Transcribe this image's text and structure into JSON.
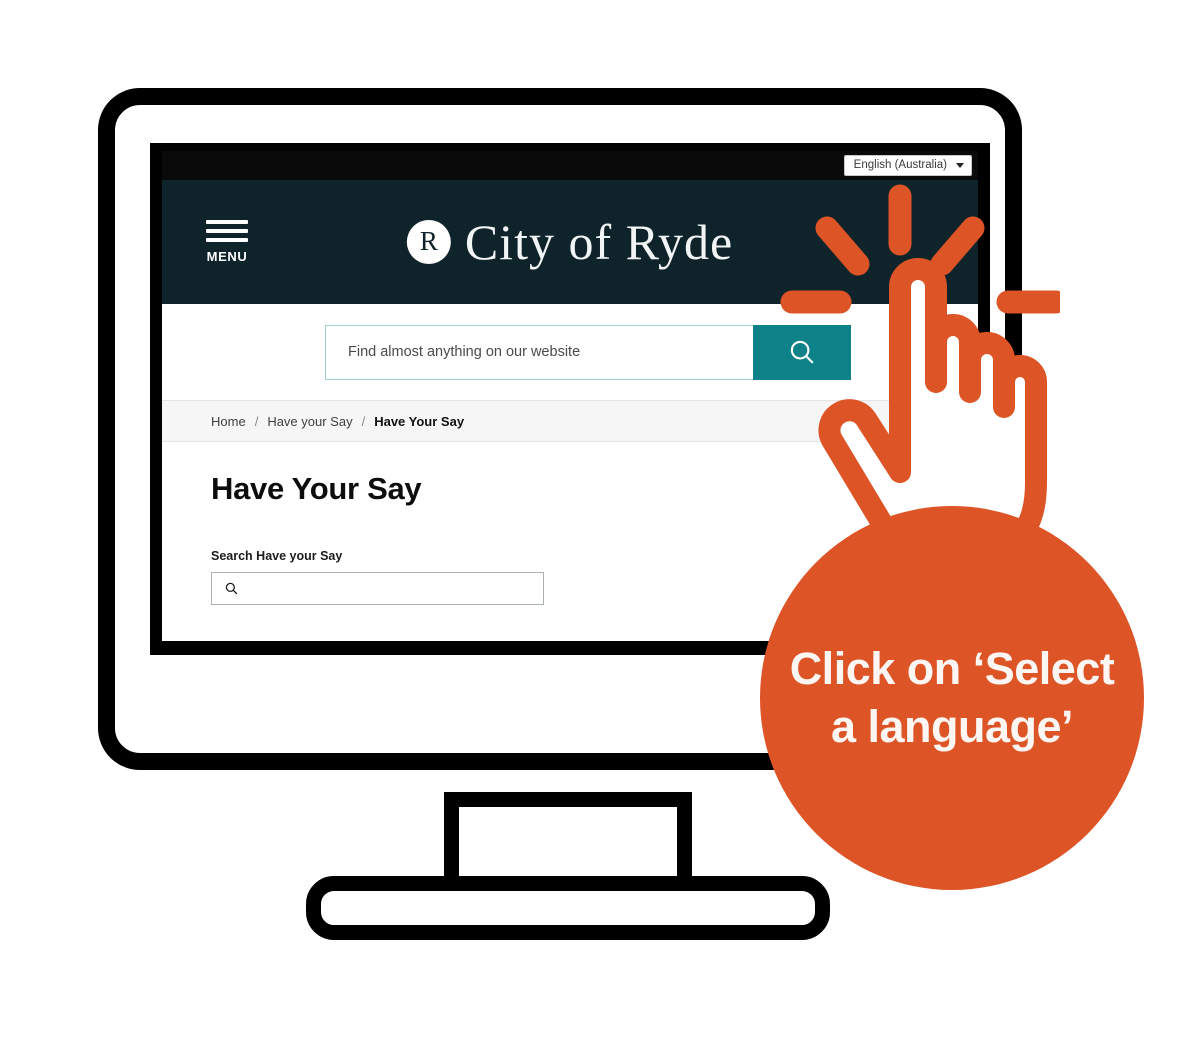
{
  "topbar": {
    "language_selected": "English (Australia)",
    "caret_icon": "chevron-down-icon"
  },
  "header": {
    "menu_label": "MENU",
    "menu_icon": "hamburger-icon",
    "brand_monogram": "R",
    "brand_name": "City of Ryde",
    "background_color": "#0f232b"
  },
  "search": {
    "placeholder": "Find almost anything on our website",
    "value": "",
    "button_icon": "search-icon",
    "button_color": "#0e8289"
  },
  "breadcrumb": {
    "items": [
      {
        "label": "Home",
        "current": false
      },
      {
        "label": "Have your Say",
        "current": false
      },
      {
        "label": "Have Your Say",
        "current": true
      }
    ],
    "separator": "/"
  },
  "main": {
    "title": "Have Your Say",
    "search_field": {
      "label": "Search Have your Say",
      "value": "",
      "placeholder": "",
      "icon": "search-icon"
    }
  },
  "annotation": {
    "callout_text": "Click on ‘Select a language’",
    "callout_color": "#dd5427",
    "pointer_icon": "pointing-hand-cursor-icon",
    "ray_icon": "tap-rays-icon"
  },
  "device": {
    "frame_color": "#000000",
    "screen_background": "#ffffff"
  }
}
